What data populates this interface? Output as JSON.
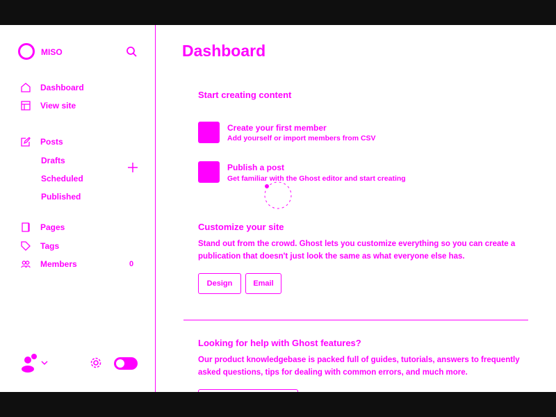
{
  "sidebar": {
    "brand": "MISO",
    "items": [
      {
        "label": "Dashboard",
        "icon": "home-icon"
      },
      {
        "label": "View site",
        "icon": "layout-icon"
      },
      {
        "label": "Posts",
        "icon": "edit-icon"
      },
      {
        "label": "Pages",
        "icon": "page-icon"
      },
      {
        "label": "Tags",
        "icon": "tag-icon"
      },
      {
        "label": "Members",
        "icon": "members-icon",
        "count": "0"
      }
    ],
    "post_subitems": [
      "Drafts",
      "Scheduled",
      "Published"
    ]
  },
  "main": {
    "title": "Dashboard",
    "start": {
      "heading": "Start creating content",
      "items": [
        {
          "title": "Create your first member",
          "desc": "Add yourself or import members from CSV"
        },
        {
          "title": "Publish a post",
          "desc": "Get familiar with the Ghost editor and start creating"
        }
      ]
    },
    "customize": {
      "heading": "Customize your site",
      "text": "Stand out from the crowd. Ghost lets you customize everything so you can create a publication that doesn't just look the same as what everyone else has.",
      "buttons": [
        "Design",
        "Email"
      ]
    },
    "help": {
      "heading": "Looking for help with Ghost features?",
      "text": "Our product knowledgebase is packed full of guides, tutorials, answers to frequently asked questions, tips for dealing with common errors, and much more."
    }
  },
  "colors": {
    "accent": "#ff00ff",
    "frame": "#0f0f0f"
  }
}
